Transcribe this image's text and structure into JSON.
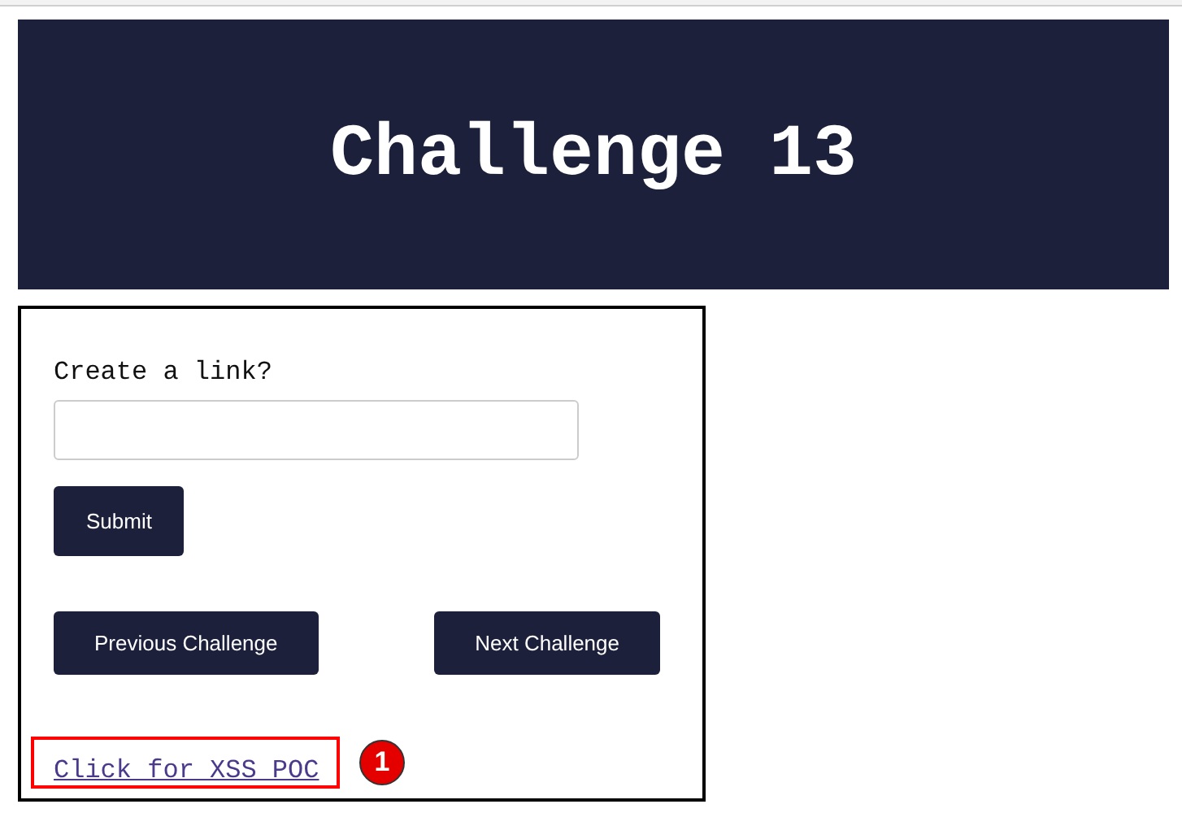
{
  "header": {
    "title": "Challenge 13"
  },
  "form": {
    "label": "Create a link?",
    "submit": "Submit"
  },
  "navigation": [
    "Previous Challenge",
    "Next Challenge"
  ],
  "link": {
    "text": "Click for XSS POC"
  },
  "annotation": {
    "badge": "1"
  }
}
